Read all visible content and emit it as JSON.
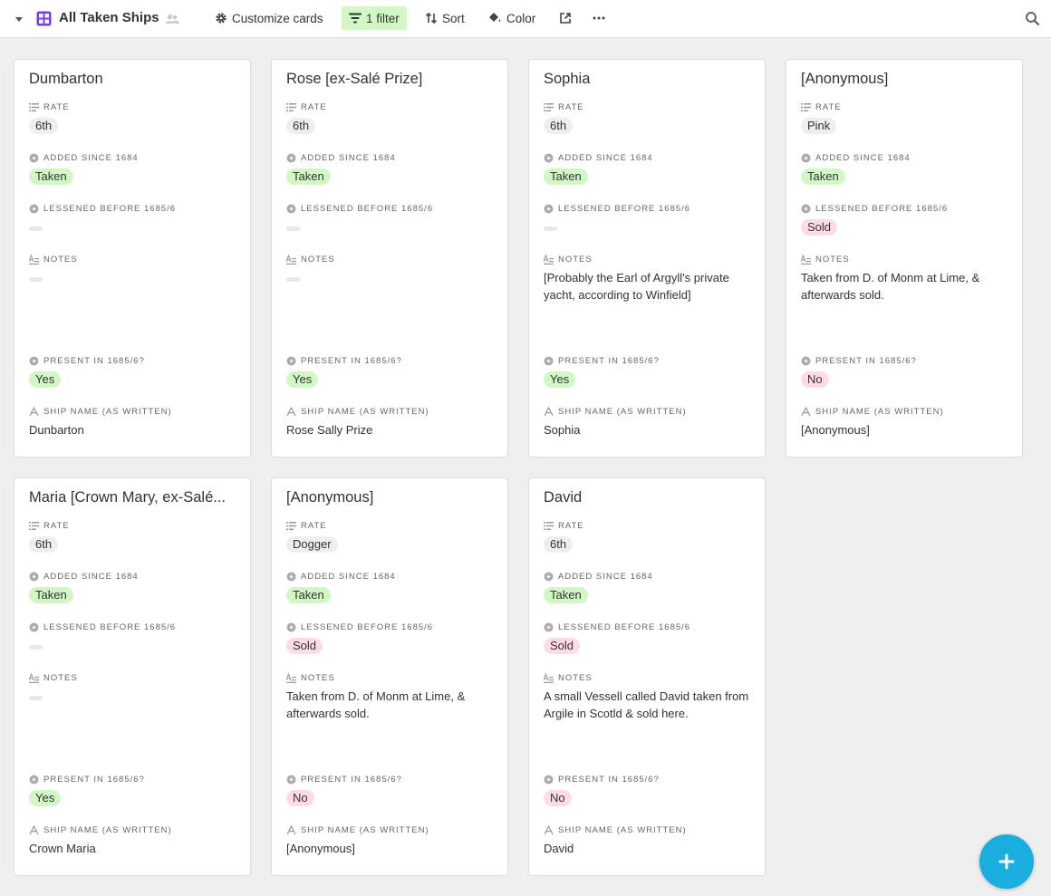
{
  "toolbar": {
    "view_title": "All Taken Ships",
    "customize_label": "Customize cards",
    "filter_label": "1 filter",
    "sort_label": "Sort",
    "color_label": "Color",
    "colors": {
      "filter_bg": "#d1f7c4",
      "view_icon": "#7c3aed"
    }
  },
  "field_labels": {
    "rate": "RATE",
    "added": "ADDED SINCE 1684",
    "lessened": "LESSENED BEFORE 1685/6",
    "notes": "NOTES",
    "present": "PRESENT IN 1685/6?",
    "ship_name": "SHIP NAME (AS WRITTEN)"
  },
  "cards": [
    {
      "title": "Dumbarton",
      "rate": "6th",
      "added": "Taken",
      "lessened": "",
      "notes": "",
      "present": "Yes",
      "ship_name": "Dunbarton"
    },
    {
      "title": "Rose [ex-Salé Prize]",
      "rate": "6th",
      "added": "Taken",
      "lessened": "",
      "notes": "",
      "present": "Yes",
      "ship_name": "Rose Sally Prize"
    },
    {
      "title": "Sophia",
      "rate": "6th",
      "added": "Taken",
      "lessened": "",
      "notes": "[Probably the Earl of Argyll's private yacht, according to Winfield]",
      "present": "Yes",
      "ship_name": "Sophia"
    },
    {
      "title": "[Anonymous]",
      "rate": "Pink",
      "added": "Taken",
      "lessened": "Sold",
      "notes": "Taken from D. of Monm at Lime, & afterwards sold.",
      "present": "No",
      "ship_name": "[Anonymous]"
    },
    {
      "title": "Maria [Crown Mary, ex-Salé...",
      "rate": "6th",
      "added": "Taken",
      "lessened": "",
      "notes": "",
      "present": "Yes",
      "ship_name": "Crown Maria"
    },
    {
      "title": "[Anonymous]",
      "rate": "Dogger",
      "added": "Taken",
      "lessened": "Sold",
      "notes": "Taken from D. of Monm at Lime, & afterwards sold.",
      "present": "No",
      "ship_name": "[Anonymous]"
    },
    {
      "title": "David",
      "rate": "6th",
      "added": "Taken",
      "lessened": "Sold",
      "notes": "A small Vessell called David taken from Argile in Scotld & sold here.",
      "present": "No",
      "ship_name": "David"
    }
  ],
  "icons": {
    "chevron": "chevron-down-icon",
    "view": "gallery-view-icon",
    "people": "collaborators-icon",
    "customize": "gear-icon",
    "filter": "filter-icon",
    "sort": "sort-icon",
    "color": "paint-bucket-icon",
    "share": "share-icon",
    "more": "more-icon",
    "search": "search-icon",
    "add": "add-icon"
  }
}
